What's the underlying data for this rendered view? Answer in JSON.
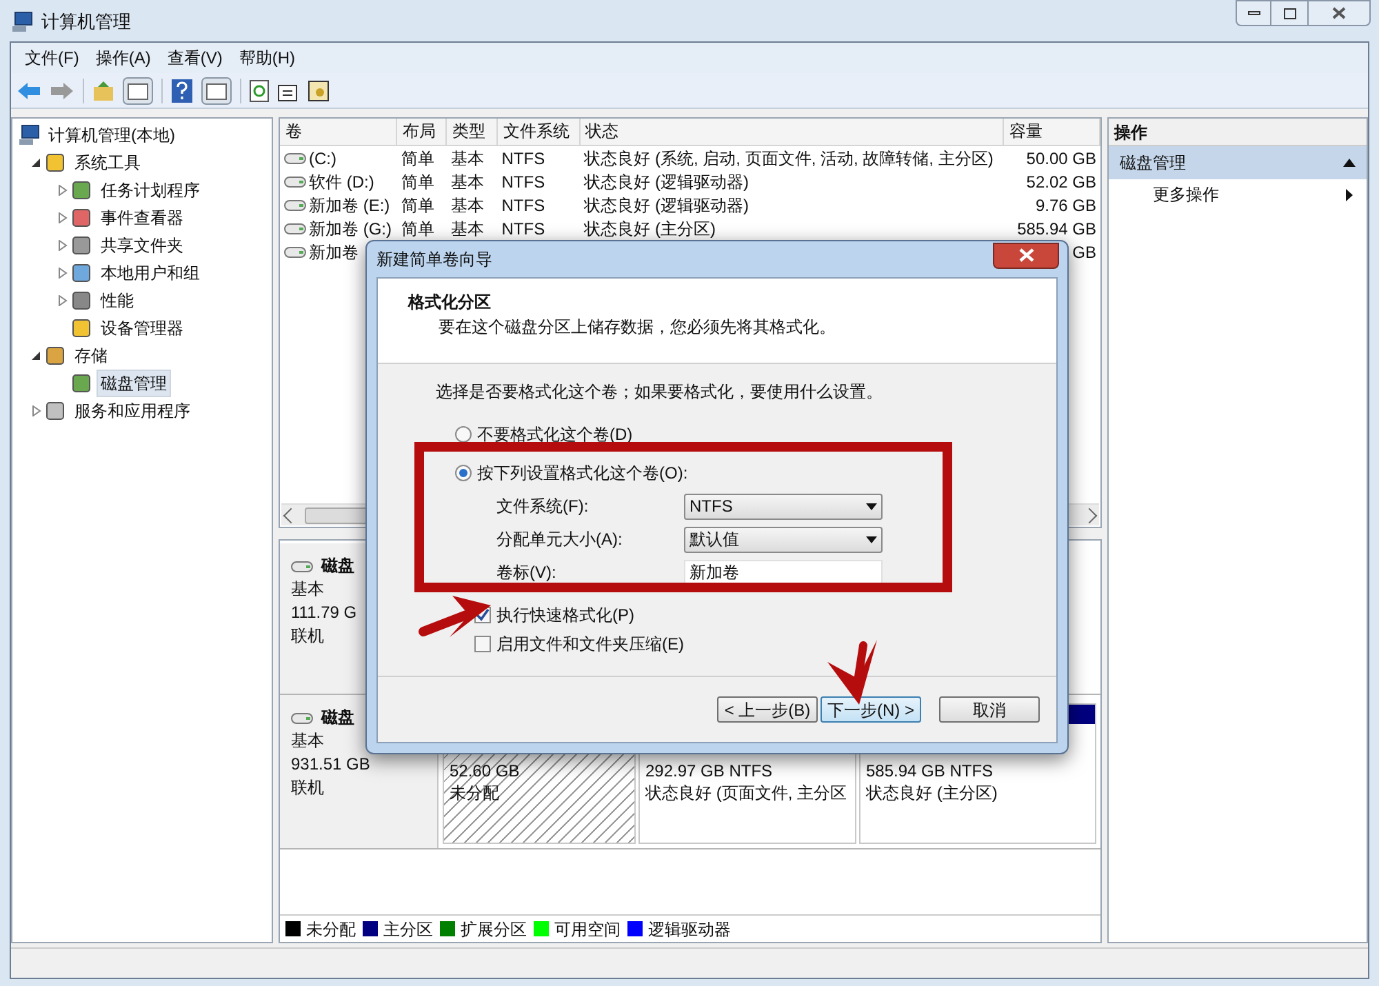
{
  "window": {
    "title": "计算机管理"
  },
  "menu": [
    "文件(F)",
    "操作(A)",
    "查看(V)",
    "帮助(H)"
  ],
  "tree": {
    "label": "计算机管理(本地)",
    "selected": false,
    "children": [
      {
        "label": "系统工具",
        "expanded": true,
        "selected": false,
        "children": [
          {
            "label": "任务计划程序",
            "expanded": false,
            "selected": false
          },
          {
            "label": "事件查看器",
            "expanded": false,
            "selected": false
          },
          {
            "label": "共享文件夹",
            "expanded": false,
            "selected": false
          },
          {
            "label": "本地用户和组",
            "expanded": false,
            "selected": false
          },
          {
            "label": "性能",
            "expanded": false,
            "selected": false
          },
          {
            "label": "设备管理器",
            "selected": false
          }
        ]
      },
      {
        "label": "存储",
        "expanded": true,
        "selected": false,
        "children": [
          {
            "label": "磁盘管理",
            "selected": true
          }
        ]
      },
      {
        "label": "服务和应用程序",
        "expanded": false,
        "selected": false
      }
    ]
  },
  "volume_table": {
    "columns": [
      "卷",
      "布局",
      "类型",
      "文件系统",
      "状态",
      "容量"
    ],
    "rows": [
      {
        "volume": "(C:)",
        "layout": "简单",
        "type": "基本",
        "file_system": "NTFS",
        "status": "状态良好 (系统, 启动, 页面文件, 活动, 故障转储, 主分区)",
        "capacity": "50.00 GB"
      },
      {
        "volume": "软件 (D:)",
        "layout": "简单",
        "type": "基本",
        "file_system": "NTFS",
        "status": "状态良好 (逻辑驱动器)",
        "capacity": "52.02 GB"
      },
      {
        "volume": "新加卷 (E:)",
        "layout": "简单",
        "type": "基本",
        "file_system": "NTFS",
        "status": "状态良好 (逻辑驱动器)",
        "capacity": "9.76 GB"
      },
      {
        "volume": "新加卷 (G:)",
        "layout": "简单",
        "type": "基本",
        "file_system": "NTFS",
        "status": "状态良好 (主分区)",
        "capacity": "585.94 GB"
      },
      {
        "volume": "新加卷",
        "capacity": "GB"
      }
    ]
  },
  "disks": [
    {
      "name": "磁盘",
      "type": "基本",
      "size": "111.79 G",
      "state": "联机"
    },
    {
      "name": "磁盘",
      "type": "基本",
      "size": "931.51 GB",
      "state": "联机",
      "partitions": [
        {
          "kind": "unallocated",
          "size": "52.60 GB",
          "status": "未分配"
        },
        {
          "kind": "primary",
          "size": "292.97 GB NTFS",
          "status": "状态良好 (页面文件, 主分区"
        },
        {
          "kind": "primary",
          "size": "585.94 GB NTFS",
          "status": "状态良好 (主分区)"
        }
      ]
    }
  ],
  "legend": [
    {
      "label": "未分配",
      "color": "#000000"
    },
    {
      "label": "主分区",
      "color": "#000080"
    },
    {
      "label": "扩展分区",
      "color": "#008000"
    },
    {
      "label": "可用空间",
      "color": "#00ff00"
    },
    {
      "label": "逻辑驱动器",
      "color": "#0000ff"
    }
  ],
  "actions": {
    "title": "操作",
    "section": {
      "label": "磁盘管理",
      "expanded": true
    },
    "items": [
      "更多操作"
    ]
  },
  "dialog": {
    "title": "新建简单卷向导",
    "heading": "格式化分区",
    "subtitle": "要在这个磁盘分区上储存数据，您必须先将其格式化。",
    "prompt": "选择是否要格式化这个卷；如果要格式化，要使用什么设置。",
    "options": [
      {
        "label": "不要格式化这个卷(D)",
        "selected": false
      },
      {
        "label": "按下列设置格式化这个卷(O):",
        "selected": true
      }
    ],
    "fields": [
      {
        "kind": "select",
        "label": "文件系统(F):",
        "value": "NTFS"
      },
      {
        "kind": "select",
        "label": "分配单元大小(A):",
        "value": "默认值"
      },
      {
        "kind": "text",
        "label": "卷标(V):",
        "value": "新加卷"
      }
    ],
    "checkboxes": [
      {
        "label": "执行快速格式化(P)",
        "checked": true
      },
      {
        "label": "启用文件和文件夹压缩(E)",
        "checked": false
      }
    ],
    "buttons": [
      {
        "label": "< 上一步(B)",
        "default": false
      },
      {
        "label": "下一步(N) >",
        "default": true
      },
      {
        "label": "取消",
        "default": false
      }
    ]
  }
}
